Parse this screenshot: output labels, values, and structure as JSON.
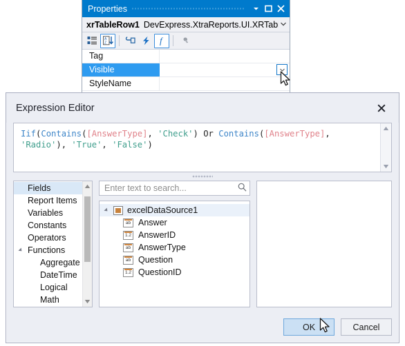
{
  "properties_panel": {
    "title": "Properties",
    "titlebar_buttons": [
      {
        "name": "dropdown",
        "glyph": "▼"
      },
      {
        "name": "maximize",
        "glyph": "□"
      },
      {
        "name": "close",
        "glyph": "✕"
      }
    ],
    "object": {
      "name": "xrTableRow1",
      "type": "DevExpress.XtraReports.UI.XRTableRo",
      "caret": "▼"
    },
    "toolbar": [
      {
        "name": "categorized-icon",
        "label": "Categorized",
        "active": false
      },
      {
        "name": "alphabetical-sort-icon",
        "label": "Alphabetical",
        "active": true
      },
      {
        "name": "properties-icon",
        "label": "Properties",
        "active": false
      },
      {
        "name": "events-icon",
        "label": "Events",
        "active": false
      },
      {
        "name": "expressions-icon",
        "label": "Expressions",
        "active": true
      },
      {
        "name": "property-pages-icon",
        "label": "Property Pages",
        "active": false
      }
    ],
    "grid_rows": [
      {
        "name": "Tag",
        "value": "",
        "selected": false,
        "has_dropdown": false
      },
      {
        "name": "Visible",
        "value": "",
        "selected": true,
        "has_dropdown": true
      },
      {
        "name": "StyleName",
        "value": "",
        "selected": false,
        "has_dropdown": false
      }
    ]
  },
  "expression_editor": {
    "title": "Expression Editor",
    "close_glyph": "✕",
    "expression_tokens": [
      {
        "t": "Iif",
        "k": "fn"
      },
      {
        "t": "(",
        "k": "punct"
      },
      {
        "t": "Contains",
        "k": "fn"
      },
      {
        "t": "(",
        "k": "punct"
      },
      {
        "t": "[AnswerType]",
        "k": "field"
      },
      {
        "t": ", ",
        "k": "punct"
      },
      {
        "t": "'Check'",
        "k": "str"
      },
      {
        "t": ") ",
        "k": "punct"
      },
      {
        "t": "Or",
        "k": "op"
      },
      {
        "t": " ",
        "k": "punct"
      },
      {
        "t": "Contains",
        "k": "fn"
      },
      {
        "t": "(",
        "k": "punct"
      },
      {
        "t": "[AnswerType]",
        "k": "field"
      },
      {
        "t": ", ",
        "k": "punct"
      },
      {
        "t": "'Radio'",
        "k": "str"
      },
      {
        "t": "), ",
        "k": "punct"
      },
      {
        "t": "'True'",
        "k": "str"
      },
      {
        "t": ", ",
        "k": "punct"
      },
      {
        "t": "'False'",
        "k": "str"
      },
      {
        "t": ")",
        "k": "punct"
      }
    ],
    "expression_plain": "Iif(Contains([AnswerType], 'Check') Or Contains([AnswerType], 'Radio'), 'True', 'False')",
    "categories": [
      {
        "label": "Fields",
        "selected": true,
        "child": false,
        "expandable": false
      },
      {
        "label": "Report Items",
        "selected": false,
        "child": false,
        "expandable": false
      },
      {
        "label": "Variables",
        "selected": false,
        "child": false,
        "expandable": false
      },
      {
        "label": "Constants",
        "selected": false,
        "child": false,
        "expandable": false
      },
      {
        "label": "Operators",
        "selected": false,
        "child": false,
        "expandable": false
      },
      {
        "label": "Functions",
        "selected": false,
        "child": false,
        "expandable": true
      },
      {
        "label": "Aggregate",
        "selected": false,
        "child": true,
        "expandable": false
      },
      {
        "label": "DateTime",
        "selected": false,
        "child": true,
        "expandable": false
      },
      {
        "label": "Logical",
        "selected": false,
        "child": true,
        "expandable": false
      },
      {
        "label": "Math",
        "selected": false,
        "child": true,
        "expandable": false
      }
    ],
    "search": {
      "placeholder": "Enter text to search...",
      "value": "",
      "icon": "search-icon"
    },
    "tree": {
      "root": {
        "label": "excelDataSource1",
        "icon": "datasource-icon",
        "selected": true
      },
      "fields": [
        {
          "label": "Answer",
          "icon": "string-field-icon",
          "icon_text": "ab"
        },
        {
          "label": "AnswerID",
          "icon": "number-field-icon",
          "icon_text": "1.2"
        },
        {
          "label": "AnswerType",
          "icon": "string-field-icon",
          "icon_text": "ab"
        },
        {
          "label": "Question",
          "icon": "string-field-icon",
          "icon_text": "ab"
        },
        {
          "label": "QuestionID",
          "icon": "number-field-icon",
          "icon_text": "1.2"
        }
      ]
    },
    "description_panel": {
      "text": ""
    },
    "buttons": [
      {
        "label": "OK",
        "name": "ok-button",
        "hover": true
      },
      {
        "label": "Cancel",
        "name": "cancel-button",
        "hover": false
      }
    ]
  },
  "colors": {
    "titlebar_blue": "#007acc",
    "selection_blue": "#2e9bf0",
    "dialog_bg": "#eceef4",
    "function_token": "#3d85c8",
    "field_token": "#e0828a",
    "string_token": "#3f9e8c",
    "button_hover": "#cbe0f4"
  }
}
